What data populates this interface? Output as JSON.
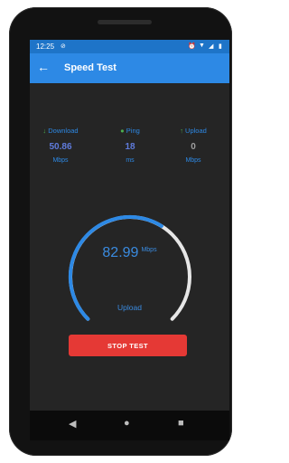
{
  "statusbar": {
    "time": "12:25",
    "icons": [
      "vpn-icon",
      "alarm-icon",
      "wifi-icon",
      "signal-icon",
      "battery-icon"
    ]
  },
  "appbar": {
    "title": "Speed Test",
    "back_icon": "back-arrow-icon"
  },
  "stats": {
    "download": {
      "label": "Download",
      "value": "50.86",
      "unit": "Mbps"
    },
    "ping": {
      "label": "Ping",
      "value": "18",
      "unit": "ms"
    },
    "upload": {
      "label": "Upload",
      "value": "0",
      "unit": "Mbps"
    }
  },
  "gauge": {
    "value": "82.99",
    "unit": "Mbps",
    "label": "Upload"
  },
  "actions": {
    "stop_label": "STOP TEST"
  },
  "colors": {
    "accent": "#2d89e5",
    "status_bar": "#1e74c8",
    "stop_button": "#e53935",
    "ping_dot": "#4caf50",
    "download_value": "#5f7bdc",
    "ping_value": "#5f7bdc",
    "upload_value": "#9e9e9e"
  },
  "navbar": {
    "icons": [
      "back-triangle-icon",
      "home-circle-icon",
      "recents-square-icon"
    ]
  }
}
